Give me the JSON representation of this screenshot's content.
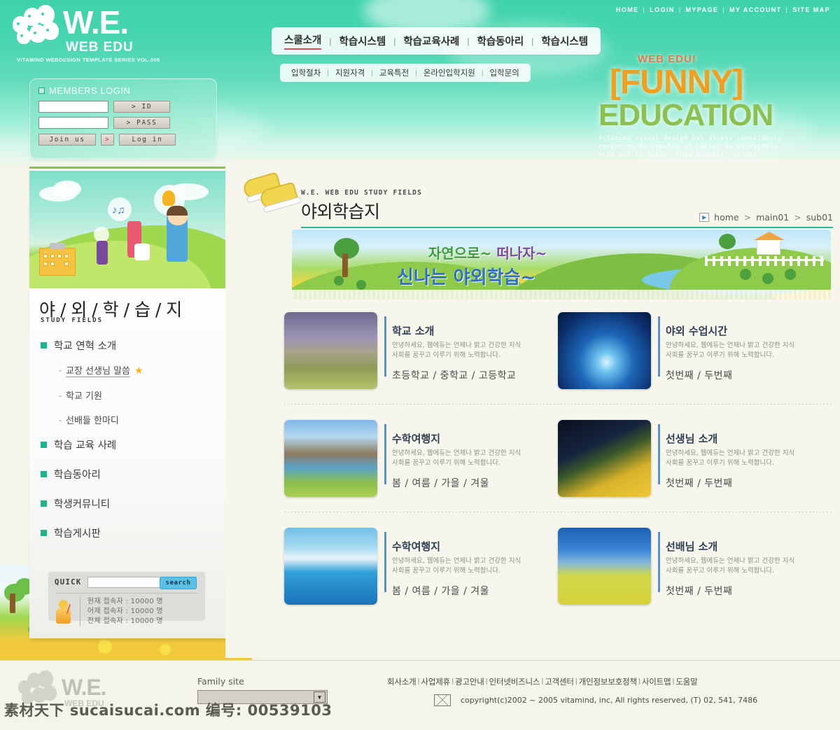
{
  "brand": {
    "logo_main": "W.E.",
    "logo_sub": "WEB EDU",
    "logo_tagline": "VITAMIND WEBDESIGN TEMPLATE SERIES VOL.005"
  },
  "utility_nav": [
    {
      "label": "HOME"
    },
    {
      "label": "LOGIN"
    },
    {
      "label": "MYPAGE"
    },
    {
      "label": "MY ACCOUNT"
    },
    {
      "label": "SITE MAP"
    }
  ],
  "main_nav": [
    {
      "label": "스쿨소개",
      "active": true
    },
    {
      "label": "학습시스템",
      "active": false
    },
    {
      "label": "학습교육사례",
      "active": false
    },
    {
      "label": "학습동아리",
      "active": false
    },
    {
      "label": "학습시스템",
      "active": false
    }
  ],
  "sub_nav": [
    {
      "label": "입학절차"
    },
    {
      "label": "지원자격"
    },
    {
      "label": "교육특전"
    },
    {
      "label": "온라인입학지원"
    },
    {
      "label": "입학문의"
    }
  ],
  "hero": {
    "web_edu": "WEB EDU!",
    "funny": "[FUNNY]",
    "education": "EDUCATION",
    "blurb_line1": "Vitamind visual design has always consciously",
    "blurb_line2": "chosen to be capable of taking on everything",
    "blurb_line3": "from dot to shape. This however, is not"
  },
  "login": {
    "title": "MEMBERS LOGIN",
    "id_value": "",
    "pass_value": "",
    "id_placeholder": "",
    "pass_placeholder": "",
    "id_button": "> ID",
    "pass_button": "> PASS",
    "join_button": "Join us",
    "join_arrow": ">",
    "login_button": "Log in"
  },
  "sidebar": {
    "title": "야 / 외 / 학 / 습 / 지",
    "subtitle": "STUDY FIELDS",
    "menu": [
      {
        "label": "학교 연혁 소개",
        "children": [
          {
            "label": "교장 선생님 말씀",
            "starred": true,
            "active": true
          },
          {
            "label": "학교 기원",
            "starred": false,
            "active": false
          },
          {
            "label": "선배들 한마디",
            "starred": false,
            "active": false
          }
        ]
      },
      {
        "label": "학습 교육 사례",
        "children": []
      },
      {
        "label": "학습동아리",
        "children": []
      },
      {
        "label": "학생커뮤니티",
        "children": []
      },
      {
        "label": "학습게시판",
        "children": []
      }
    ],
    "quick": {
      "label": "QUICK",
      "search_value": "",
      "search_placeholder": "",
      "search_button": "search",
      "stats": [
        "현재 접속자 : 10000  명",
        "어제 접속자 : 10000  명",
        "전체 접속자 : 10000  명"
      ]
    }
  },
  "content": {
    "eyebrow": "W.E. WEB EDU STUDY FIELDS",
    "title": "야외학습지",
    "breadcrumb": [
      "home",
      "main01",
      "sub01"
    ],
    "breadcrumb_sep": ">",
    "banner": {
      "line1_a": "자연으로~ ",
      "line1_b": "떠나자~",
      "line2": "신나는 야외학습~"
    },
    "cards": [
      {
        "title": "학교 소개",
        "desc_line1": "안녕하세요, 웹에듀는 언제나 밝고 건강한 지식",
        "desc_line2": "사회를 꿈꾸고 이루기 위해 노력합니다.",
        "links": "초등학교 / 중학교 / 고등학교",
        "thumb": "th1"
      },
      {
        "title": "야외 수업시간",
        "desc_line1": "안녕하세요, 웹에듀는 언제나 밝고 건강한 지식",
        "desc_line2": "사회를 꿈꾸고 이루기 위해 노력합니다.",
        "links": "첫번째 / 두번째",
        "thumb": "th2"
      },
      {
        "title": "수학여행지",
        "desc_line1": "안녕하세요, 웹에듀는 언제나 밝고 건강한 지식",
        "desc_line2": "사회를 꿈꾸고 이루기 위해 노력합니다.",
        "links": "봄 / 여름 /  가을  / 겨울",
        "thumb": "th3"
      },
      {
        "title": "선생님 소개",
        "desc_line1": "안녕하세요, 웹에듀는 언제나 밝고 건강한 지식",
        "desc_line2": "사회를 꿈꾸고 이루기 위해 노력합니다.",
        "links": "첫번째 / 두번째",
        "thumb": "th4"
      },
      {
        "title": "수학여행지",
        "desc_line1": "안녕하세요, 웹에듀는 언제나 밝고 건강한 지식",
        "desc_line2": "사회를 꿈꾸고 이루기 위해 노력합니다.",
        "links": "봄 / 여름 /  가을  / 겨울",
        "thumb": "th5"
      },
      {
        "title": "선배님 소개",
        "desc_line1": "안녕하세요, 웹에듀는 언제나 밝고 건강한 지식",
        "desc_line2": "사회를 꿈꾸고 이루기 위해 노력합니다.",
        "links": "첫번째 / 두번째",
        "thumb": "th6"
      }
    ]
  },
  "footer": {
    "logo_main": "W.E.",
    "logo_sub": "WEB EDU",
    "family_label": "Family site",
    "family_value": "",
    "links": [
      "회사소개",
      "사업제휴",
      "광고안내",
      "인터넷비즈니스",
      "고객센터",
      "개인정보보호정책",
      "사이트맵",
      "도움말"
    ],
    "link_sep": "l",
    "copyright": "copyright(c)2002 ~ 2005 vitamind, inc,  All rights reserved, (T) 02, 541, 7486"
  },
  "watermark": "素材天下 sucaisucai.com  编号: 00539103",
  "colors": {
    "sky_top": "#3fd3ab",
    "accent_green": "#19b58e",
    "accent_blue": "#5b8fc9",
    "rule": "#2bb89a",
    "nav_active_underline": "#d8544f",
    "funny_orange": "#f0a020",
    "education_green": "#8cc152",
    "content_bg": "#f7f6ec",
    "search_button": "#5bc0e6"
  }
}
